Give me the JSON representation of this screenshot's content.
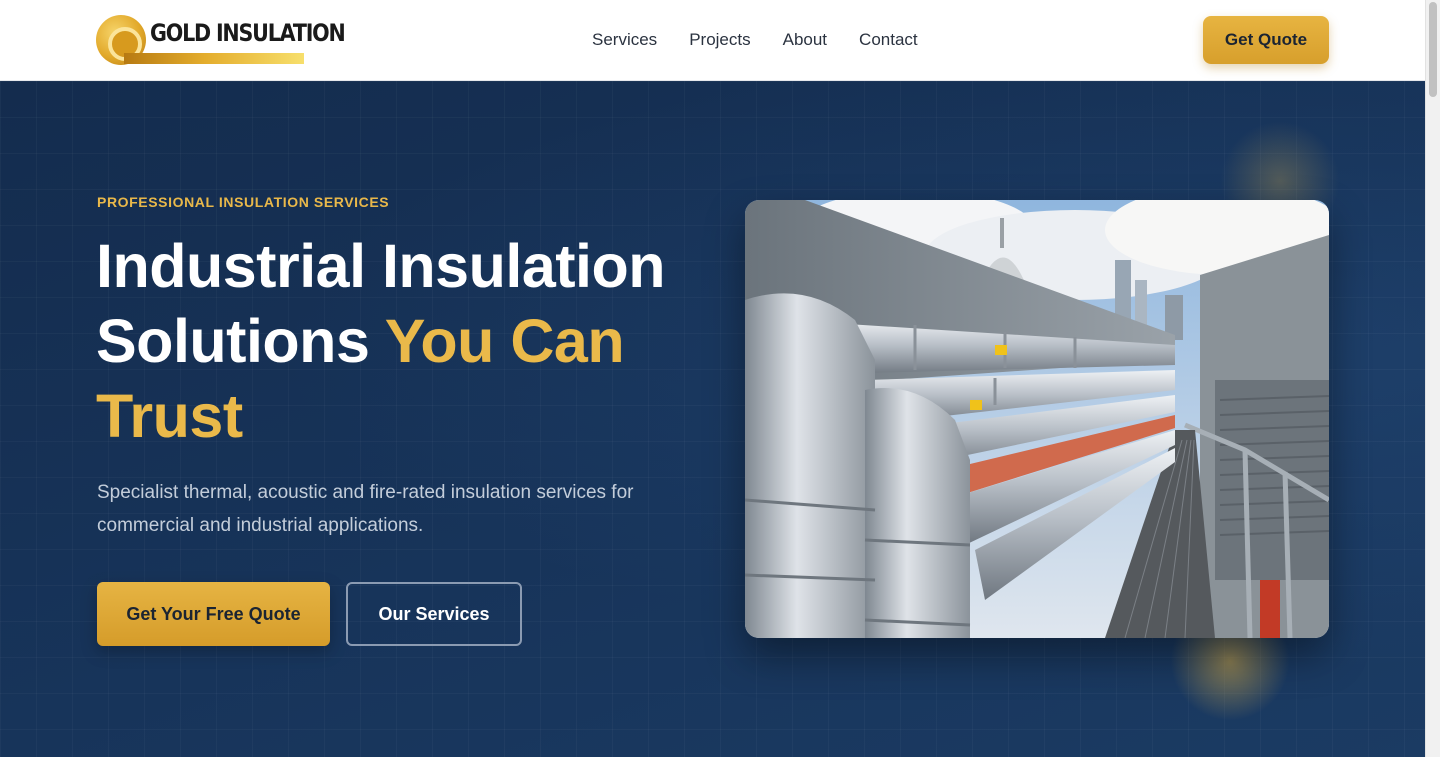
{
  "brand": {
    "name": "GOLD INSULATION"
  },
  "nav": {
    "items": [
      "Services",
      "Projects",
      "About",
      "Contact"
    ]
  },
  "header": {
    "cta_label": "Get Quote"
  },
  "hero": {
    "eyebrow": "PROFESSIONAL INSULATION SERVICES",
    "title_line_1": "Industrial Insulation",
    "title_line_2_plain": "Solutions ",
    "title_line_2_accent": "You Can",
    "title_line_3_accent": "Trust",
    "subtitle": "Specialist thermal, acoustic and fire-rated insulation services for commercial and industrial applications.",
    "primary_cta": "Get Your Free Quote",
    "secondary_cta": "Our Services",
    "image_icon": "insulated-pipework-rooftop-photo"
  },
  "colors": {
    "accent": "#e9b84a",
    "hero_bg": "#17345a",
    "text_dark": "#1b2432"
  }
}
